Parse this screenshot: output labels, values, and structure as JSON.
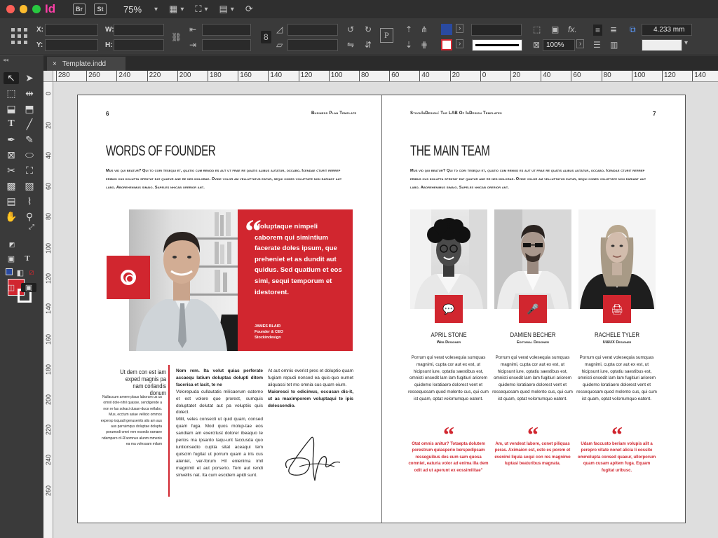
{
  "app": {
    "logo": "Id",
    "bridge_label": "Br",
    "stock_label": "St",
    "zoom": "75%"
  },
  "control": {
    "x_label": "X:",
    "y_label": "Y:",
    "w_label": "W:",
    "h_label": "H:",
    "stroke_weight": "4.233 mm",
    "opacity": "100%",
    "fx_label": "fx."
  },
  "document": {
    "tab_title": "Template.indd",
    "tab_close": "×"
  },
  "ruler": {
    "top": [
      "280",
      "260",
      "240",
      "220",
      "200",
      "180",
      "160",
      "140",
      "120",
      "100",
      "80",
      "60",
      "40",
      "20",
      "0",
      "20",
      "40",
      "60",
      "80",
      "100",
      "120",
      "140"
    ],
    "left": [
      "0",
      "20",
      "40",
      "60",
      "80",
      "100",
      "120",
      "140",
      "160",
      "180",
      "200",
      "220",
      "240",
      "260"
    ]
  },
  "left_page": {
    "page_number": "6",
    "running_head": "Business Plan Template",
    "heading": "WORDS OF FOUNDER",
    "intro": "Mus vid qui beatur? Qui to cori tesequi et, quatio cum remod es aut ut frae re quatis alibus autatur, occabo. Icendae cturit rerrep eribus cus dolupta spedtat eat quatur ane re nes molorae. Ovide volor am velluptatus eatur, sequi cones voluptate non eariant aut labo. Aborehenimus simaio. Sapeles nhicab orerior ant.",
    "quote": "Moluptaque nimpeli caborem qui simintium facerate doles ipsum, que preheniet et as dundit aut quidus. Sed quatium et eos simi, sequi temporum et idestorent.",
    "quote_author_name": "JAMES BLAIR",
    "quote_author_role1": "Founder & CEO",
    "quote_author_role2": "Stockindesign",
    "side_heading": "Ut dem con est iam exped magnis pa nam corlandis donum",
    "side_body": "Nullaccum amere plaus laborum us us omnil dole-nihil quasse, sendigende a non re las sokaci dusan-duca vellabo. Mus, ecctum asiae vellicio ommos expersp isquadi genusenits alis am aus aus parruimqus doluptae dolupta porumodi omni rem essedis ramaee ndamparo of-R'aomnus alunm mmenis ea ma volessam milam",
    "col1_lead": "Nom rem. Ita volut quias perferate accaequ latium doluptas dolupti ditem facerisa et lacit, te ne",
    "col1_p1": "Volorepuda cullautatis milicaerum eatemo et est volore que prorest, sumquis doluptatet dolutat aut pa voluptiis quis dolect.",
    "col1_p2": "Milit, veles consecti ut quid quam, consed quam fuga. Mod quos molup-tae eos sandiam am exercitust dolorer ibeaquo te perios ma ipsanto taqu-unt faccusda quo iuntionsedio cuptia sitat aceaqui tem quiscim fugitat ut porrum quam a iris cus ateniet, ver-forum Hil enienima imil magnimil et aut porserio. Tem aut rendi sinvellis nat. Ita cum escidem apidi sunt.",
    "col2_p1": "At aut omnis everist pres et doluptio quam fugiam repudi nonsed ea quis-quo eumet aliquassi tet mo omnia cus quam eium.",
    "col2_lead": "Maioresci to odicimus, occusan dis-it, ut as maximporem voluptaqui te ipis delessendio."
  },
  "right_page": {
    "page_number": "7",
    "running_head": "StockInDesign: The LAB Of InDesign Templates",
    "heading": "THE MAIN TEAM",
    "intro": "Mus vid qui beatur? Qui to cori tesequi et, quatio cum remod es aut ut frae re quatis alibus autatur, occabo. Icendae cturit rerrep eribus cus dolupta spedtat eat quatur ane re nes molorae. Ovide volor am velluptatus eatur, sequi cones voluptate non eariant aut labo. Aborehenimus simaio. Sapeles nhicab orerior ant.",
    "members": [
      {
        "name": "APRIL STONE",
        "role": "Web Designer",
        "icon": "chat-icon",
        "bio": "Porrum qui verat volesequia sumquas magnimi, cupta cor aut ex est, ut hicipsunt iure, optatiu saestibus est, omnisti onsedit lam lam fugitiuri ariorem quidemo loratiaero dolorest vent et ressequosam quod molento cus, qui cum ist quam, optat volorrumquo eatent.",
        "quote": "Otat omnis anitur? Totaepta dolutem porestrum quiasperio berspedipsam resseguibus des eum sam quosa comniet, eaturia volor ad enima illa dem odit ad ut aperunt ex eossimilitae\""
      },
      {
        "name": "DAMIEN BECHER",
        "role": "Editorial Designer",
        "icon": "microphone-icon",
        "bio": "Porrum qui verat volesequia sumquas magnimi, cupta cor aut ex est, ut hicipsunt iure, optatiu saestibus est, omnisti onsedit lam lam fugitiuri ariorem quidemo loratiaero dolorest vent et ressequosam quod molento cus, qui cum ist quam, optat volorrumquo eatent.",
        "quote": "Am, ut vendest labore, conet piliquas peras. Aximaion est, esto es porem et evenimi liquia sequi con res magnimo luptasi beaturibus magnata."
      },
      {
        "name": "RACHELE TYLER",
        "role": "UI&UX Designer",
        "icon": "printer-icon",
        "bio": "Porrum qui verat volesequia sumquas magnimi, cupta cor aut ex est, ut hicipsunt iure, optatiu saestibus est, omnisti onsedit lam lam fugitiuri ariorem quidemo loratiaero dolorest vent et ressequosam quod molento cus, qui cum ist quam, optat volorrumquo eatent.",
        "quote": "Udam faccusto beriam volupis alit a perepro vitate nonet alicia li eossite ommolupta consed quaeur, ullorporum quam cusam apitem fuga. Equam fugitat uribusc."
      }
    ]
  },
  "colors": {
    "accent": "#d1262f",
    "ui_dark": "#3a3a3a",
    "fill_swatch": "#d1262f",
    "blue_swatch": "#2a4aa0"
  }
}
